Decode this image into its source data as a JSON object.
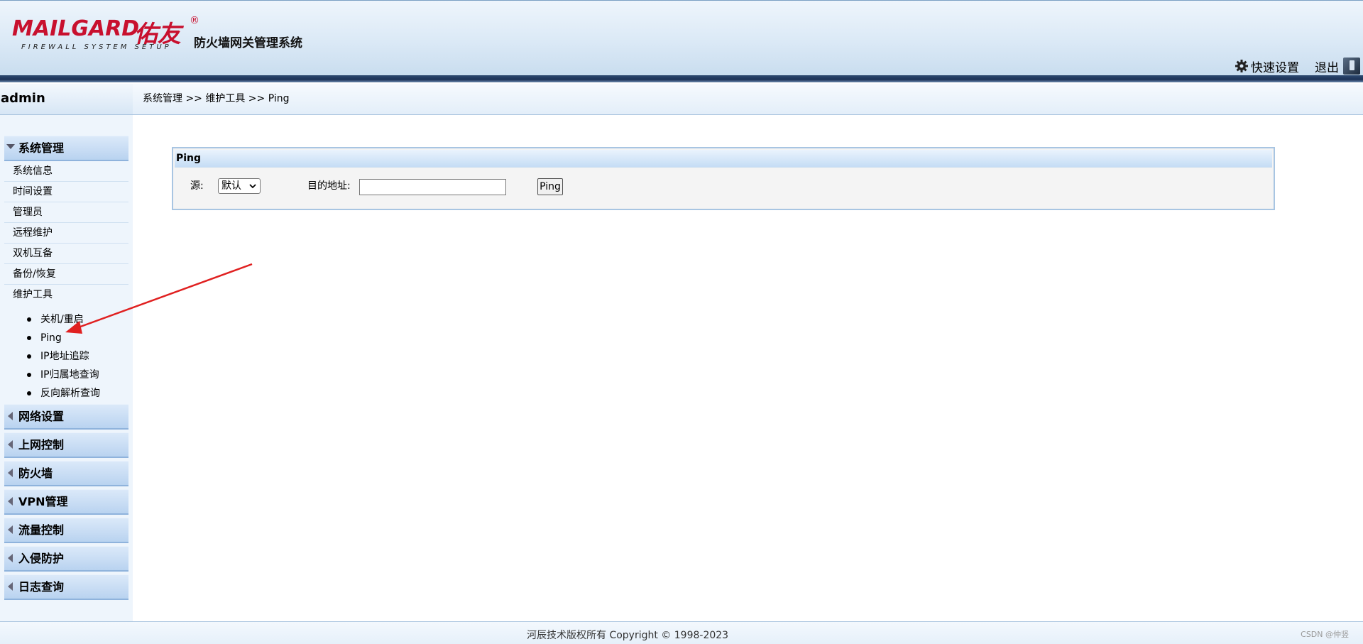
{
  "header": {
    "logo_word": "MAILGARD",
    "logo_brand": "佑友",
    "logo_reg": "®",
    "logo_sub": "FIREWALL SYSTEM SETUP",
    "system_title": "防火墙网关管理系统",
    "quick_setup": "快速设置",
    "logout": "退出"
  },
  "user": {
    "name": "admin"
  },
  "breadcrumb": "系统管理 >> 维护工具 >> Ping",
  "sidebar": {
    "system_group": "系统管理",
    "system_items": [
      "系统信息",
      "时间设置",
      "管理员",
      "远程维护",
      "双机互备",
      "备份/恢复",
      "维护工具"
    ],
    "maintenance_leaves": [
      "关机/重启",
      "Ping",
      "IP地址追踪",
      "IP归属地查询",
      "反向解析查询"
    ],
    "collapsed_groups": [
      "网络设置",
      "上网控制",
      "防火墙",
      "VPN管理",
      "流量控制",
      "入侵防护",
      "日志查询"
    ]
  },
  "panel": {
    "title": "Ping",
    "source_label": "源:",
    "source_value": "默认",
    "target_label": "目的地址:",
    "target_value": "",
    "button_label": "Ping"
  },
  "footer": {
    "copyright": "河辰技术版权所有 Copyright © 1998-2023",
    "watermark": "CSDN @仲竖"
  },
  "colors": {
    "brand_red": "#c8102e",
    "annotation_red": "#e02020",
    "header_band": "#1b3257",
    "panel_border": "#a8c5e2"
  }
}
